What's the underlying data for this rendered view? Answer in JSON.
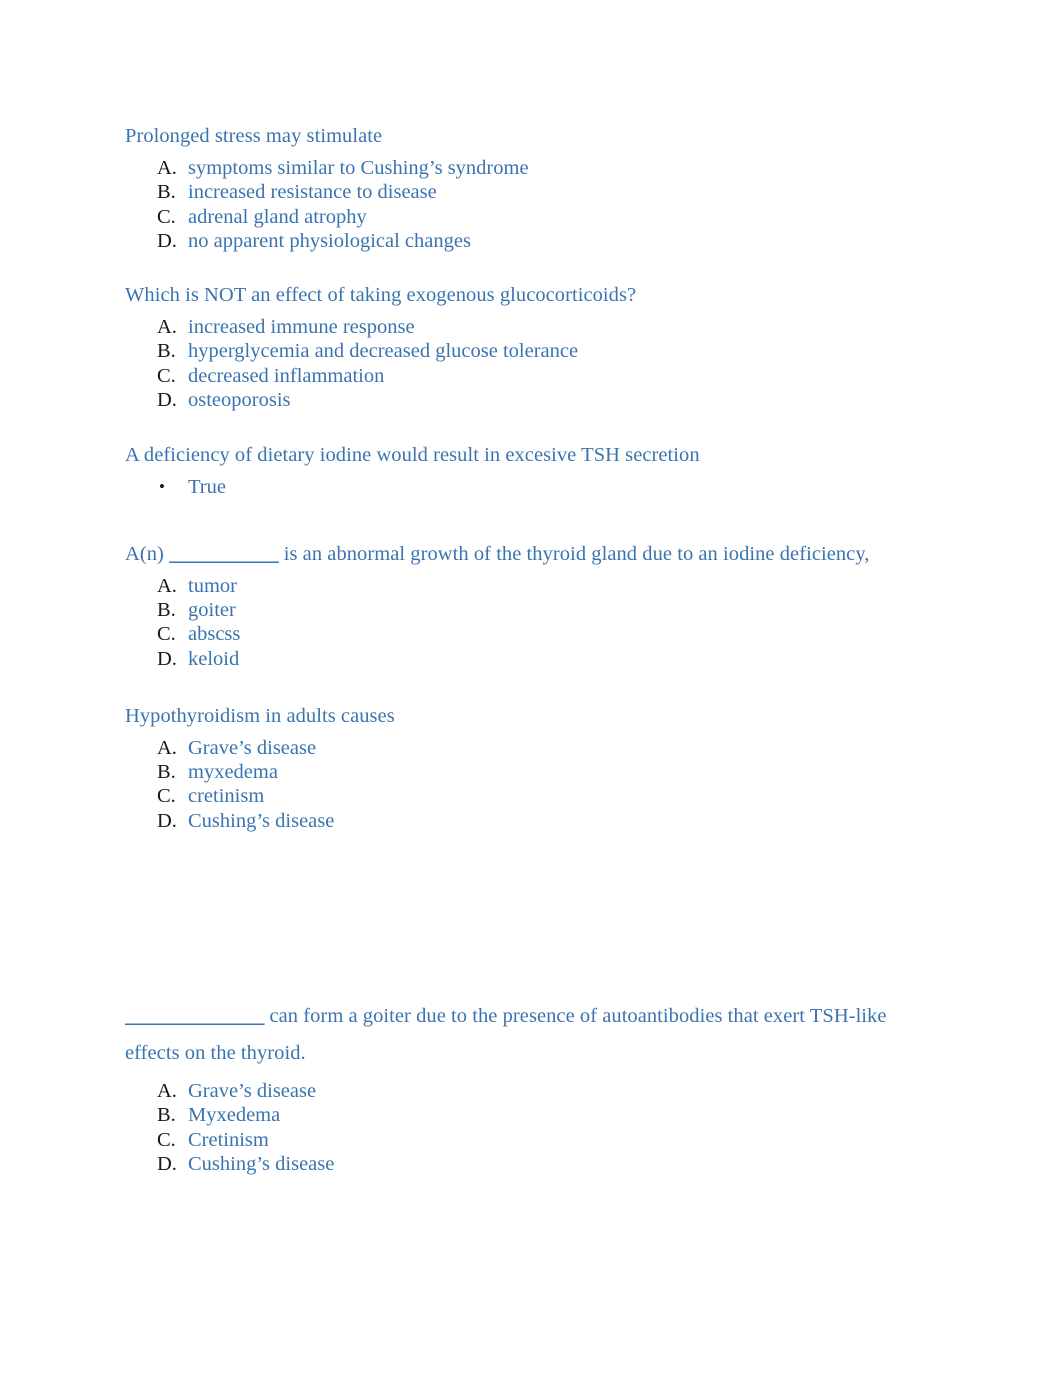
{
  "document": {
    "theme_color": "#3a74b0",
    "marker_color": "#181818",
    "background": "#ffffff"
  },
  "questions": [
    {
      "id": "q1",
      "prompt": "Prolonged stress may stimulate",
      "list_type": "lettered",
      "options": [
        {
          "marker": "A.",
          "label": "symptoms similar to Cushing’s syndrome"
        },
        {
          "marker": "B.",
          "label": "increased resistance to disease"
        },
        {
          "marker": "C.",
          "label": "adrenal gland atrophy"
        },
        {
          "marker": "D.",
          "label": "no apparent physiological changes"
        }
      ]
    },
    {
      "id": "q2",
      "prompt": "Which is NOT an effect of taking exogenous glucocorticoids?",
      "list_type": "lettered",
      "options": [
        {
          "marker": "A.",
          "label": "increased immune response"
        },
        {
          "marker": "B.",
          "label": "hyperglycemia and decreased glucose tolerance"
        },
        {
          "marker": "C.",
          "label": "decreased inflammation"
        },
        {
          "marker": "D.",
          "label": "osteoporosis"
        }
      ]
    },
    {
      "id": "q3",
      "prompt": "A deficiency of dietary iodine would result in excesive TSH secretion",
      "list_type": "bulleted",
      "options": [
        {
          "marker": "•",
          "label": "True"
        }
      ]
    },
    {
      "id": "q4",
      "prompt_prefix": "A(n) ",
      "prompt_blank": "___________",
      "prompt_suffix": " is an abnormal growth of the thyroid gland due to an iodine deficiency,",
      "list_type": "lettered",
      "options": [
        {
          "marker": "A.",
          "label": "tumor"
        },
        {
          "marker": "B.",
          "label": "goiter"
        },
        {
          "marker": "C.",
          "label": "abscss"
        },
        {
          "marker": "D.",
          "label": "keloid"
        }
      ]
    },
    {
      "id": "q5",
      "prompt": "Hypothyroidism in adults causes",
      "list_type": "lettered",
      "options": [
        {
          "marker": "A.",
          "label": "Grave’s disease"
        },
        {
          "marker": "B.",
          "label": "myxedema"
        },
        {
          "marker": "C.",
          "label": "cretinism"
        },
        {
          "marker": "D.",
          "label": "Cushing’s disease"
        }
      ]
    },
    {
      "id": "q6",
      "prompt_prefix": "",
      "prompt_blank": "______________",
      "prompt_suffix": " can form a goiter due to the presence of autoantibodies that exert TSH-like effects on the thyroid.",
      "list_type": "lettered",
      "options": [
        {
          "marker": "A.",
          "label": "Grave’s disease"
        },
        {
          "marker": "B.",
          "label": "Myxedema"
        },
        {
          "marker": "C.",
          "label": "Cretinism"
        },
        {
          "marker": "D.",
          "label": "Cushing’s disease"
        }
      ]
    }
  ]
}
